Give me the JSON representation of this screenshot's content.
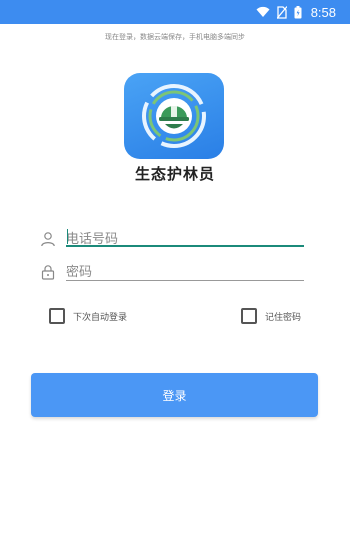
{
  "status_bar": {
    "time": "8:58",
    "icons": [
      "wifi-icon",
      "no-sim-icon",
      "battery-icon"
    ]
  },
  "notice": "现在登录，数据云端保存，手机电脑多端同步",
  "app": {
    "name": "生态护林员",
    "logo_icon": "forest-ranger-helmet-logo-icon"
  },
  "form": {
    "phone": {
      "placeholder": "电话号码",
      "value": "",
      "icon": "user-icon"
    },
    "password": {
      "placeholder": "密码",
      "value": "",
      "icon": "lock-icon"
    },
    "auto_login_label": "下次自动登录",
    "remember_password_label": "记住密码",
    "login_button": "登录"
  },
  "colors": {
    "status_bar": "#3d8cf0",
    "accent": "#4b97f5",
    "focus_underline": "#1b8a7a"
  }
}
